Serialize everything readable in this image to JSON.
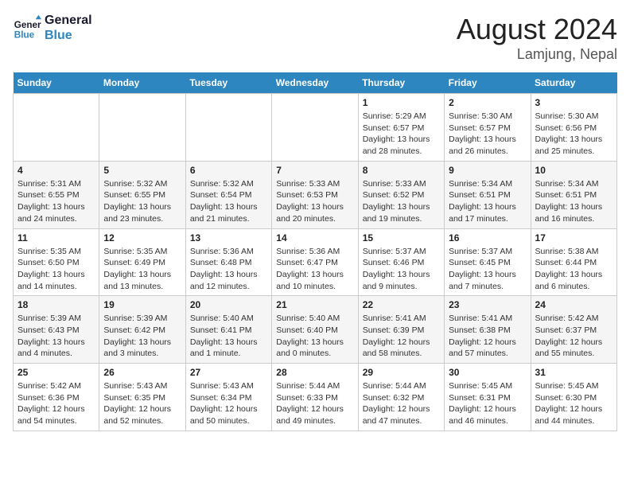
{
  "header": {
    "logo_line1": "General",
    "logo_line2": "Blue",
    "title": "August 2024",
    "subtitle": "Lamjung, Nepal"
  },
  "weekdays": [
    "Sunday",
    "Monday",
    "Tuesday",
    "Wednesday",
    "Thursday",
    "Friday",
    "Saturday"
  ],
  "weeks": [
    [
      {
        "num": "",
        "detail": ""
      },
      {
        "num": "",
        "detail": ""
      },
      {
        "num": "",
        "detail": ""
      },
      {
        "num": "",
        "detail": ""
      },
      {
        "num": "1",
        "detail": "Sunrise: 5:29 AM\nSunset: 6:57 PM\nDaylight: 13 hours\nand 28 minutes."
      },
      {
        "num": "2",
        "detail": "Sunrise: 5:30 AM\nSunset: 6:57 PM\nDaylight: 13 hours\nand 26 minutes."
      },
      {
        "num": "3",
        "detail": "Sunrise: 5:30 AM\nSunset: 6:56 PM\nDaylight: 13 hours\nand 25 minutes."
      }
    ],
    [
      {
        "num": "4",
        "detail": "Sunrise: 5:31 AM\nSunset: 6:55 PM\nDaylight: 13 hours\nand 24 minutes."
      },
      {
        "num": "5",
        "detail": "Sunrise: 5:32 AM\nSunset: 6:55 PM\nDaylight: 13 hours\nand 23 minutes."
      },
      {
        "num": "6",
        "detail": "Sunrise: 5:32 AM\nSunset: 6:54 PM\nDaylight: 13 hours\nand 21 minutes."
      },
      {
        "num": "7",
        "detail": "Sunrise: 5:33 AM\nSunset: 6:53 PM\nDaylight: 13 hours\nand 20 minutes."
      },
      {
        "num": "8",
        "detail": "Sunrise: 5:33 AM\nSunset: 6:52 PM\nDaylight: 13 hours\nand 19 minutes."
      },
      {
        "num": "9",
        "detail": "Sunrise: 5:34 AM\nSunset: 6:51 PM\nDaylight: 13 hours\nand 17 minutes."
      },
      {
        "num": "10",
        "detail": "Sunrise: 5:34 AM\nSunset: 6:51 PM\nDaylight: 13 hours\nand 16 minutes."
      }
    ],
    [
      {
        "num": "11",
        "detail": "Sunrise: 5:35 AM\nSunset: 6:50 PM\nDaylight: 13 hours\nand 14 minutes."
      },
      {
        "num": "12",
        "detail": "Sunrise: 5:35 AM\nSunset: 6:49 PM\nDaylight: 13 hours\nand 13 minutes."
      },
      {
        "num": "13",
        "detail": "Sunrise: 5:36 AM\nSunset: 6:48 PM\nDaylight: 13 hours\nand 12 minutes."
      },
      {
        "num": "14",
        "detail": "Sunrise: 5:36 AM\nSunset: 6:47 PM\nDaylight: 13 hours\nand 10 minutes."
      },
      {
        "num": "15",
        "detail": "Sunrise: 5:37 AM\nSunset: 6:46 PM\nDaylight: 13 hours\nand 9 minutes."
      },
      {
        "num": "16",
        "detail": "Sunrise: 5:37 AM\nSunset: 6:45 PM\nDaylight: 13 hours\nand 7 minutes."
      },
      {
        "num": "17",
        "detail": "Sunrise: 5:38 AM\nSunset: 6:44 PM\nDaylight: 13 hours\nand 6 minutes."
      }
    ],
    [
      {
        "num": "18",
        "detail": "Sunrise: 5:39 AM\nSunset: 6:43 PM\nDaylight: 13 hours\nand 4 minutes."
      },
      {
        "num": "19",
        "detail": "Sunrise: 5:39 AM\nSunset: 6:42 PM\nDaylight: 13 hours\nand 3 minutes."
      },
      {
        "num": "20",
        "detail": "Sunrise: 5:40 AM\nSunset: 6:41 PM\nDaylight: 13 hours\nand 1 minute."
      },
      {
        "num": "21",
        "detail": "Sunrise: 5:40 AM\nSunset: 6:40 PM\nDaylight: 13 hours\nand 0 minutes."
      },
      {
        "num": "22",
        "detail": "Sunrise: 5:41 AM\nSunset: 6:39 PM\nDaylight: 12 hours\nand 58 minutes."
      },
      {
        "num": "23",
        "detail": "Sunrise: 5:41 AM\nSunset: 6:38 PM\nDaylight: 12 hours\nand 57 minutes."
      },
      {
        "num": "24",
        "detail": "Sunrise: 5:42 AM\nSunset: 6:37 PM\nDaylight: 12 hours\nand 55 minutes."
      }
    ],
    [
      {
        "num": "25",
        "detail": "Sunrise: 5:42 AM\nSunset: 6:36 PM\nDaylight: 12 hours\nand 54 minutes."
      },
      {
        "num": "26",
        "detail": "Sunrise: 5:43 AM\nSunset: 6:35 PM\nDaylight: 12 hours\nand 52 minutes."
      },
      {
        "num": "27",
        "detail": "Sunrise: 5:43 AM\nSunset: 6:34 PM\nDaylight: 12 hours\nand 50 minutes."
      },
      {
        "num": "28",
        "detail": "Sunrise: 5:44 AM\nSunset: 6:33 PM\nDaylight: 12 hours\nand 49 minutes."
      },
      {
        "num": "29",
        "detail": "Sunrise: 5:44 AM\nSunset: 6:32 PM\nDaylight: 12 hours\nand 47 minutes."
      },
      {
        "num": "30",
        "detail": "Sunrise: 5:45 AM\nSunset: 6:31 PM\nDaylight: 12 hours\nand 46 minutes."
      },
      {
        "num": "31",
        "detail": "Sunrise: 5:45 AM\nSunset: 6:30 PM\nDaylight: 12 hours\nand 44 minutes."
      }
    ]
  ]
}
